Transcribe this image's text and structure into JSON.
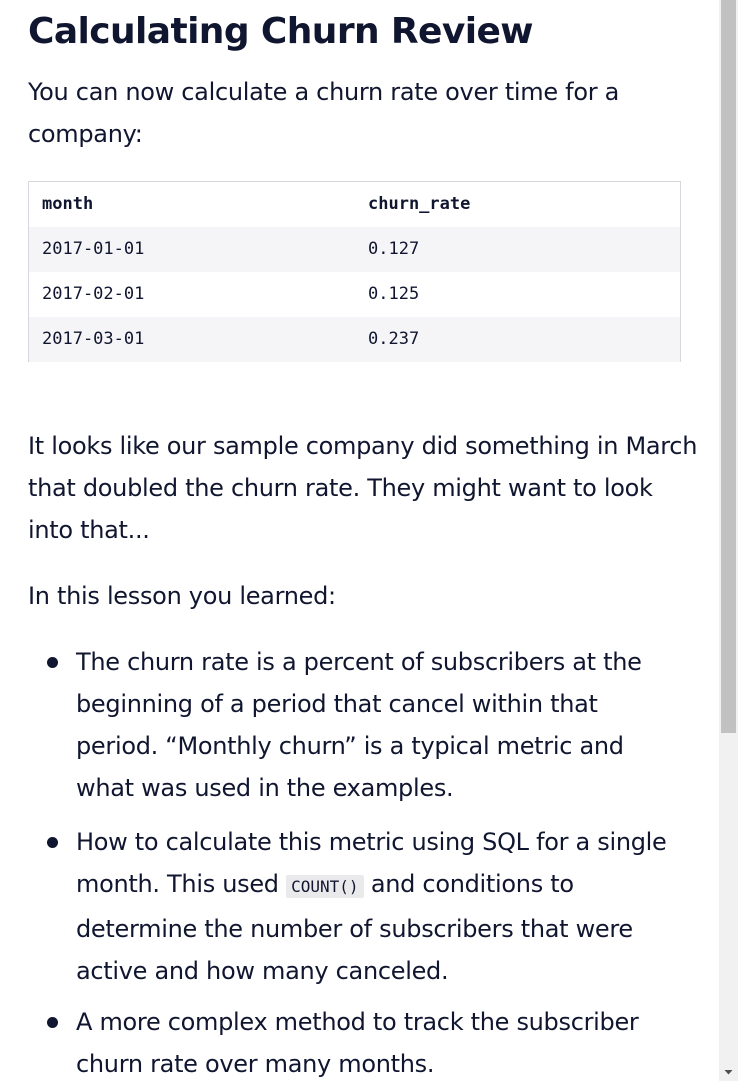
{
  "lesson": {
    "title": "Calculating Churn Review",
    "intro": "You can now calculate a churn rate over time for a company:",
    "table": {
      "headers": [
        "month",
        "churn_rate"
      ],
      "rows": [
        [
          "2017-01-01",
          "0.127"
        ],
        [
          "2017-02-01",
          "0.125"
        ],
        [
          "2017-03-01",
          "0.237"
        ]
      ]
    },
    "observation": "It looks like our sample company did something in March that doubled the churn rate. They might want to look into that...",
    "learned_intro": "In this lesson you learned:",
    "bullets": {
      "item1": "The churn rate is a percent of subscribers at the beginning of a period that cancel within that period. “Monthly churn” is a typical metric and what was used in the examples.",
      "item2_before": "How to calculate this metric using SQL for a single month. This used ",
      "item2_code": "COUNT()",
      "item2_after": " and conditions to determine the number of subscribers that were active and how many canceled.",
      "item3": "A more complex method to track the subscriber churn rate over many months."
    }
  },
  "scrollbar": {
    "arrow_icon": "triangle-down-icon"
  }
}
